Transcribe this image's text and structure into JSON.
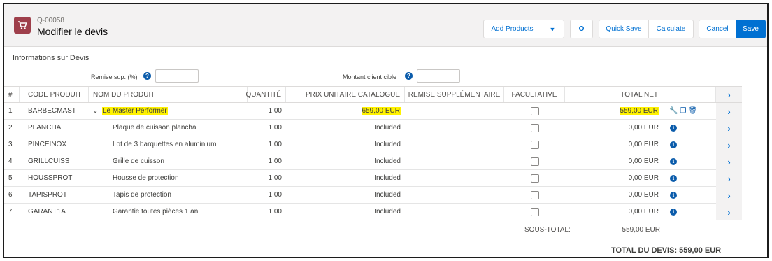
{
  "header": {
    "quote_id": "Q-00058",
    "title": "Modifier le devis",
    "buttons": {
      "add_products": "Add Products",
      "dropdown": "▼",
      "circle": "O",
      "quick_save": "Quick Save",
      "calculate": "Calculate",
      "cancel": "Cancel",
      "save": "Save"
    }
  },
  "section": {
    "title": "Informations sur Devis",
    "discount_label": "Remise sup. (%)",
    "target_label": "Montant client cible",
    "discount_value": "",
    "target_value": ""
  },
  "table": {
    "columns": {
      "num": "#",
      "code": "CODE PRODUIT",
      "name": "NOM DU PRODUIT",
      "qty": "QUANTITÉ",
      "list_price": "PRIX UNITAIRE CATALOGUE",
      "extra_discount": "REMISE SUPPLÉMENTAIRE",
      "optional": "FACULTATIVE",
      "net_total": "TOTAL NET"
    },
    "rows": [
      {
        "num": "1",
        "code": "BARBECMAST",
        "name": "Le Master Performer",
        "qty": "1,00",
        "price": "659,00 EUR",
        "net": "559,00 EUR"
      },
      {
        "num": "2",
        "code": "PLANCHA",
        "name": "Plaque de cuisson plancha",
        "qty": "1,00",
        "price": "Included",
        "net": "0,00 EUR"
      },
      {
        "num": "3",
        "code": "PINCEINOX",
        "name": "Lot de 3 barquettes en aluminium",
        "qty": "1,00",
        "price": "Included",
        "net": "0,00 EUR"
      },
      {
        "num": "4",
        "code": "GRILLCUISS",
        "name": "Grille de cuisson",
        "qty": "1,00",
        "price": "Included",
        "net": "0,00 EUR"
      },
      {
        "num": "5",
        "code": "HOUSSPROT",
        "name": "Housse de protection",
        "qty": "1,00",
        "price": "Included",
        "net": "0,00 EUR"
      },
      {
        "num": "6",
        "code": "TAPISPROT",
        "name": "Tapis de protection",
        "qty": "1,00",
        "price": "Included",
        "net": "0,00 EUR"
      },
      {
        "num": "7",
        "code": "GARANT1A",
        "name": "Garantie toutes pièces 1 an",
        "qty": "1,00",
        "price": "Included",
        "net": "0,00 EUR"
      }
    ],
    "subtotal_label": "SOUS-TOTAL:",
    "subtotal_value": "559,00 EUR"
  },
  "total": "TOTAL DU DEVIS: 559,00 EUR",
  "colors": {
    "brand": "#0070d2",
    "highlight": "#fff200",
    "object_icon": "#9e3f4b"
  },
  "icons": {
    "object": "cart-icon",
    "help": "help-icon",
    "expand": "chevron-down-icon",
    "navigate": "chevron-right-icon",
    "info": "info-icon",
    "wrench": "wrench-icon",
    "copy": "copy-icon",
    "delete": "trash-icon"
  }
}
